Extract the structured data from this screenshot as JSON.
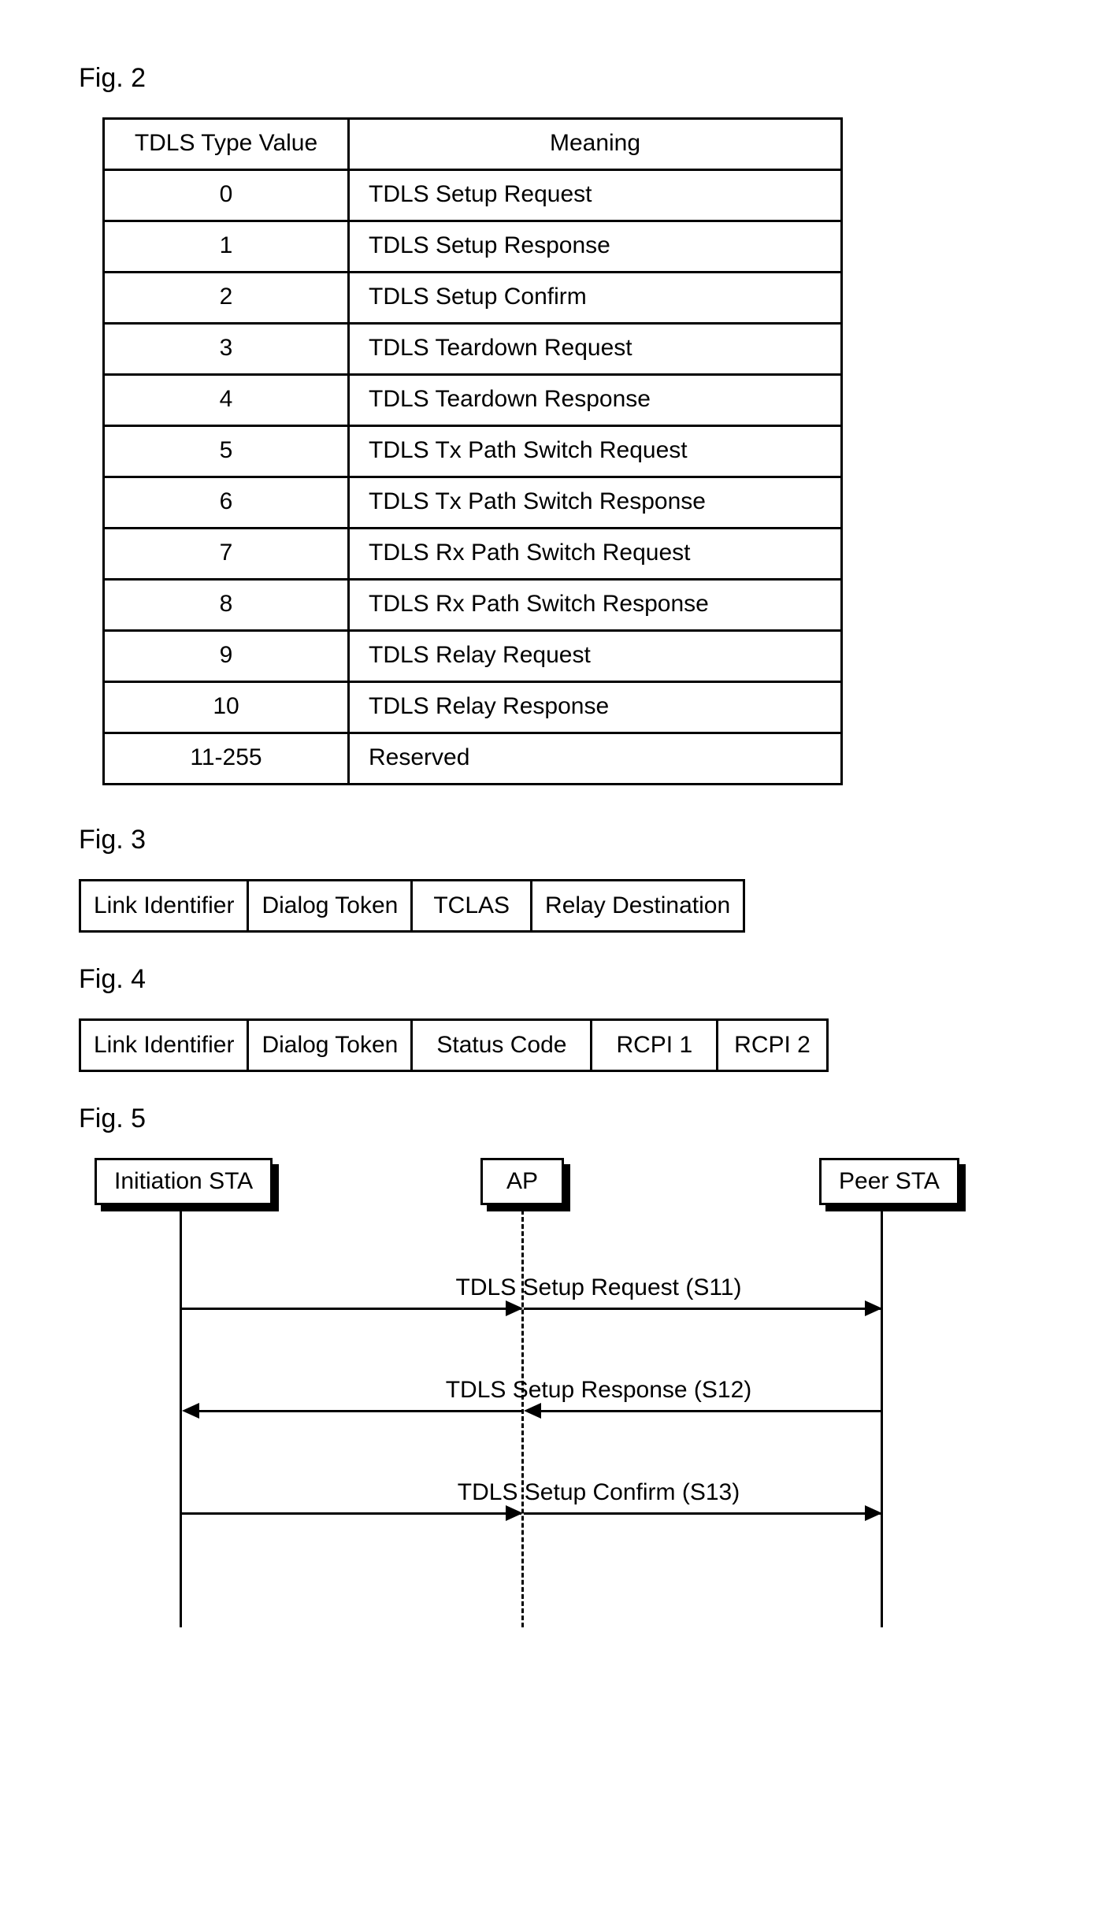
{
  "fig2": {
    "label": "Fig. 2",
    "headers": [
      "TDLS Type Value",
      "Meaning"
    ],
    "rows": [
      [
        "0",
        "TDLS Setup Request"
      ],
      [
        "1",
        "TDLS Setup Response"
      ],
      [
        "2",
        "TDLS Setup Confirm"
      ],
      [
        "3",
        "TDLS Teardown Request"
      ],
      [
        "4",
        "TDLS Teardown Response"
      ],
      [
        "5",
        "TDLS Tx Path Switch Request"
      ],
      [
        "6",
        "TDLS Tx Path Switch Response"
      ],
      [
        "7",
        "TDLS Rx Path Switch Request"
      ],
      [
        "8",
        "TDLS Rx Path Switch Response"
      ],
      [
        "9",
        "TDLS Relay Request"
      ],
      [
        "10",
        "TDLS Relay Response"
      ],
      [
        "11-255",
        "Reserved"
      ]
    ]
  },
  "fig3": {
    "label": "Fig. 3",
    "fields": [
      "Link Identifier",
      "Dialog Token",
      "TCLAS",
      "Relay Destination"
    ]
  },
  "fig4": {
    "label": "Fig. 4",
    "fields": [
      "Link Identifier",
      "Dialog Token",
      "Status Code",
      "RCPI 1",
      "RCPI 2"
    ]
  },
  "fig5": {
    "label": "Fig. 5",
    "nodes": {
      "init": "Initiation STA",
      "ap": "AP",
      "peer": "Peer STA"
    },
    "messages": [
      {
        "text": "TDLS Setup Request (S11)",
        "dir": "right"
      },
      {
        "text": "TDLS Setup Response (S12)",
        "dir": "left"
      },
      {
        "text": "TDLS Setup Confirm (S13)",
        "dir": "right"
      }
    ]
  }
}
